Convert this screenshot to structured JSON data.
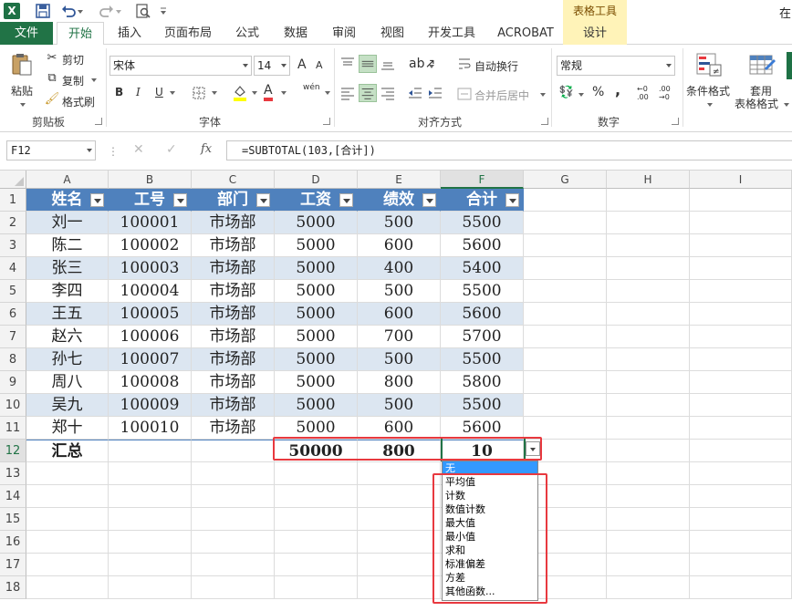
{
  "titlebar": {
    "logo": "X",
    "undo_icon": "undo-icon",
    "redo_icon": "redo-icon",
    "context_group": "表格工具",
    "corner_text": "在"
  },
  "tabs": [
    {
      "id": "file",
      "label": "文件"
    },
    {
      "id": "home",
      "label": "开始"
    },
    {
      "id": "insert",
      "label": "插入"
    },
    {
      "id": "layout",
      "label": "页面布局"
    },
    {
      "id": "formulas",
      "label": "公式"
    },
    {
      "id": "data",
      "label": "数据"
    },
    {
      "id": "review",
      "label": "审阅"
    },
    {
      "id": "view",
      "label": "视图"
    },
    {
      "id": "developer",
      "label": "开发工具"
    },
    {
      "id": "acrobat",
      "label": "ACROBAT"
    },
    {
      "id": "design",
      "label": "设计"
    }
  ],
  "ribbon": {
    "clipboard": {
      "paste": "粘贴",
      "cut": "剪切",
      "copy": "复制",
      "format_painter": "格式刷",
      "group": "剪贴板"
    },
    "font": {
      "name": "宋体",
      "size": "14",
      "bold": "B",
      "italic": "I",
      "underline": "U",
      "grow": "A",
      "shrink": "A",
      "phonetic": "wén",
      "font_color_letter": "A",
      "group": "字体"
    },
    "alignment": {
      "wrap": "自动换行",
      "merge": "合并后居中",
      "group": "对齐方式"
    },
    "number": {
      "format": "常规",
      "percent": "%",
      "comma": ",",
      "inc_decimal": "←0 .00",
      "dec_decimal": ".00 →0",
      "group": "数字"
    },
    "styles": {
      "conditional": "条件格式",
      "table_format_1": "套用",
      "table_format_2": "表格格式"
    }
  },
  "formula_bar": {
    "name_box": "F12",
    "fx": "fx",
    "formula": "=SUBTOTAL(103,[合计])"
  },
  "columns": [
    "A",
    "B",
    "C",
    "D",
    "E",
    "F",
    "G",
    "H",
    "I"
  ],
  "rows": [
    "1",
    "2",
    "3",
    "4",
    "5",
    "6",
    "7",
    "8",
    "9",
    "10",
    "11",
    "12",
    "13",
    "14",
    "15",
    "16",
    "17",
    "18"
  ],
  "table": {
    "headers": [
      "姓名",
      "工号",
      "部门",
      "工资",
      "绩效",
      "合计"
    ],
    "rows": [
      [
        "刘一",
        "100001",
        "市场部",
        "5000",
        "500",
        "5500"
      ],
      [
        "陈二",
        "100002",
        "市场部",
        "5000",
        "600",
        "5600"
      ],
      [
        "张三",
        "100003",
        "市场部",
        "5000",
        "400",
        "5400"
      ],
      [
        "李四",
        "100004",
        "市场部",
        "5000",
        "500",
        "5500"
      ],
      [
        "王五",
        "100005",
        "市场部",
        "5000",
        "600",
        "5600"
      ],
      [
        "赵六",
        "100006",
        "市场部",
        "5000",
        "700",
        "5700"
      ],
      [
        "孙七",
        "100007",
        "市场部",
        "5000",
        "500",
        "5500"
      ],
      [
        "周八",
        "100008",
        "市场部",
        "5000",
        "800",
        "5800"
      ],
      [
        "吴九",
        "100009",
        "市场部",
        "5000",
        "500",
        "5500"
      ],
      [
        "郑十",
        "100010",
        "市场部",
        "5000",
        "600",
        "5600"
      ]
    ],
    "total_row": [
      "汇总",
      "",
      "",
      "50000",
      "800",
      "10"
    ]
  },
  "total_dropdown": {
    "options": [
      "无",
      "平均值",
      "计数",
      "数值计数",
      "最大值",
      "最小值",
      "求和",
      "标准偏差",
      "方差",
      "其他函数..."
    ],
    "selected": "无"
  },
  "colors": {
    "excel_green": "#217346",
    "table_header": "#4f81bd",
    "band": "#dce6f1",
    "highlight": "#e8393f",
    "dropdown_selected": "#3399ff"
  }
}
